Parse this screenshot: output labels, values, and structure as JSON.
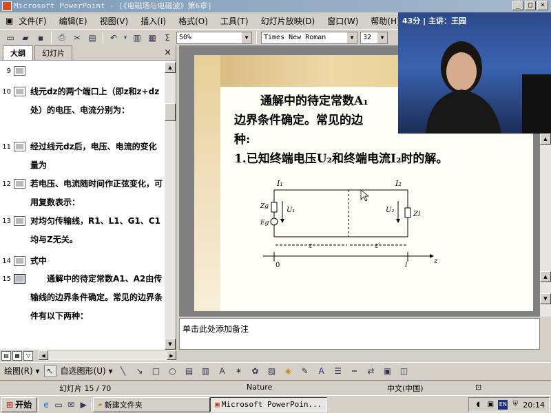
{
  "window": {
    "title": "Microsoft PowerPoint - [《电磁场与电磁波》第6章]",
    "buttons": [
      "_",
      "□",
      "×"
    ]
  },
  "menu": [
    "文件(F)",
    "编辑(E)",
    "视图(V)",
    "插入(I)",
    "格式(O)",
    "工具(T)",
    "幻灯片放映(D)",
    "窗口(W)",
    "帮助(H)"
  ],
  "toolbar": {
    "zoom": "50%",
    "font_name": "Times New Roman",
    "font_size": "32"
  },
  "outline_tabs": {
    "outline": "大纲",
    "slides": "幻灯片",
    "close": "×"
  },
  "outline_items": [
    {
      "num": "9",
      "text": ""
    },
    {
      "num": "10",
      "text": "线元dz的两个端口上（即z和z+dz处）的电压、电流分别为："
    },
    {
      "num": "11",
      "text": "经过线元dz后，电压、电流的变化量为"
    },
    {
      "num": "12",
      "text": "若电压、电流随时间作正弦变化，可用复数表示："
    },
    {
      "num": "13",
      "text": "对均匀传输线，R1、L1、G1、C1均与Z无关。"
    },
    {
      "num": "14",
      "text": "式中"
    },
    {
      "num": "15",
      "text": "通解中的待定常数A1、A2由传输线的边界条件确定。常见的边界条件有以下两种："
    }
  ],
  "slide": {
    "line1": "通解中的待定常数A₁",
    "line2": "边界条件确定。常见的边",
    "line3": "种:",
    "line4": "1.已知终端电压U₂和终端电流I₂时的解。"
  },
  "circuit": {
    "i1": "I₁",
    "i2": "I₂",
    "zg": "Zg",
    "eg": "Eg",
    "u1": "U₁",
    "u2": "U₂",
    "zl": "Zl",
    "z": "z",
    "zp": "z′",
    "origin": "0",
    "l": "l",
    "zaxis": "z"
  },
  "video": {
    "label": "43分 | 主讲：王园"
  },
  "notes": {
    "placeholder": "单击此处添加备注"
  },
  "drawbar": {
    "draw": "绘图(R) ▾",
    "autoshape": "自选图形(U) ▾"
  },
  "status": {
    "slide_count": "幻灯片 15 / 70",
    "theme": "Nature",
    "language": "中文(中国)"
  },
  "taskbar": {
    "start": "开始",
    "tasks": [
      "新建文件夹",
      "Microsoft PowerPoin..."
    ],
    "clock": "20:14",
    "lang": "EN"
  }
}
